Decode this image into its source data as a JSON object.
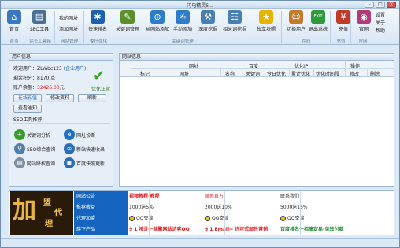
{
  "window": {
    "title": "闪电精灵5..."
  },
  "ribbon": {
    "buttons": [
      {
        "label": "首页",
        "icon": "home-icon",
        "color": "#3a78c3"
      },
      {
        "label": "SEO工具",
        "icon": "toolbox-icon",
        "color": "#4a6f95"
      },
      {
        "label": "我的网址",
        "icon": "globe-icon",
        "color": "#2f8a3c"
      },
      {
        "label": "添加网址",
        "icon": "add-icon",
        "color": "#2f8a3c"
      },
      {
        "label": "快速排名",
        "icon": "paw-icon",
        "color": "#1f5fb0"
      },
      {
        "label": "关键词管理",
        "icon": "edit-icon",
        "color": "#5b8f2a"
      },
      {
        "label": "从网站添加",
        "icon": "site-add-icon",
        "color": "#2c7cc8"
      },
      {
        "label": "手动添加",
        "icon": "hand-icon",
        "color": "#2c7cc8"
      },
      {
        "label": "深度挖掘",
        "icon": "mining-icon",
        "color": "#4a7fb6"
      },
      {
        "label": "相关词挖掘",
        "icon": "related-icon",
        "color": "#4a7fb6"
      },
      {
        "label": "独立块照",
        "icon": "star-icon",
        "color": "#e5b400"
      },
      {
        "label": "切换用户",
        "icon": "user-icon",
        "color": "#c47a2a"
      },
      {
        "label": "退出系统",
        "icon": "exit-icon",
        "color": "#2f9a3c"
      },
      {
        "label": "充值",
        "icon": "recharge-icon",
        "color": "#c03a2a"
      },
      {
        "label": "官网",
        "icon": "website-icon",
        "color": "#b03a7a"
      }
    ],
    "right_links": [
      "设置",
      "关于",
      "帮助"
    ],
    "groups": [
      "首页",
      "站长工具箱",
      "网站管理",
      "委托优化",
      "关键词管理",
      "在线",
      "充值",
      "官网"
    ],
    "exit_badge": "EXIT"
  },
  "user_panel": {
    "title": "用户信息",
    "welcome_prefix": "欢迎用户：ZLYabc123",
    "member_type": "(企业用户)",
    "points": "剩余积分：8170 点",
    "balance_label": "账户余额：",
    "balance_value": "32426.00",
    "balance_unit": "元",
    "status": "优化正常",
    "buttons": [
      "在线充值",
      "修改资料",
      "刷新",
      "查看通知"
    ],
    "tools_title": "SEO工具推荐",
    "tools": [
      {
        "label": "关键词分析",
        "icon": "plus-icon",
        "color": "#3d9a2c"
      },
      {
        "label": "网址诊断",
        "icon": "ie-icon",
        "color": "#1e6fc8"
      },
      {
        "label": "SEO综合查询",
        "icon": "search-icon",
        "color": "#4f7fa8"
      },
      {
        "label": "新站快速收录",
        "icon": "link-icon",
        "color": "#2c6db5"
      },
      {
        "label": "网站降权查询",
        "icon": "doc-icon",
        "color": "#7f8f9f"
      },
      {
        "label": "百度快照更新",
        "icon": "photo-icon",
        "color": "#2c6db5"
      }
    ]
  },
  "optimize": {
    "title": "网站信息",
    "groups": [
      "网址",
      "百度",
      "优化IP",
      "操作"
    ],
    "columns": [
      "标记",
      "网址",
      "名称",
      "关键词",
      "今日优化",
      "累计优化",
      "优化时间段",
      "修改",
      "删除"
    ]
  },
  "bottom": {
    "ad": {
      "big": "加",
      "line1": "盟",
      "line2": "代",
      "line3": "理"
    },
    "rows": [
      {
        "label": "网站公告",
        "c1": "视频教程-教程",
        "c2": "联系官方",
        "c3": "联系我们"
      },
      {
        "label": "推荐收益",
        "c1": "1000送5%",
        "c2": "2000送10%",
        "c3": "5000送15%"
      },
      {
        "label": "代理加盟",
        "c1": "QQ交谈",
        "c2": "QQ交谈",
        "c3": "QQ交谈"
      },
      {
        "label": "旗下产品",
        "c1": "9 1 按计一就聚网站访客QQ",
        "c2": "9 1 Email-- 许可式邮件营销",
        "c3": "百度排名一招搞定易-见效付款"
      }
    ],
    "colors": {
      "label_bg": "#1565c0",
      "red": "#e01b1b",
      "green": "#1a8a2a"
    }
  }
}
